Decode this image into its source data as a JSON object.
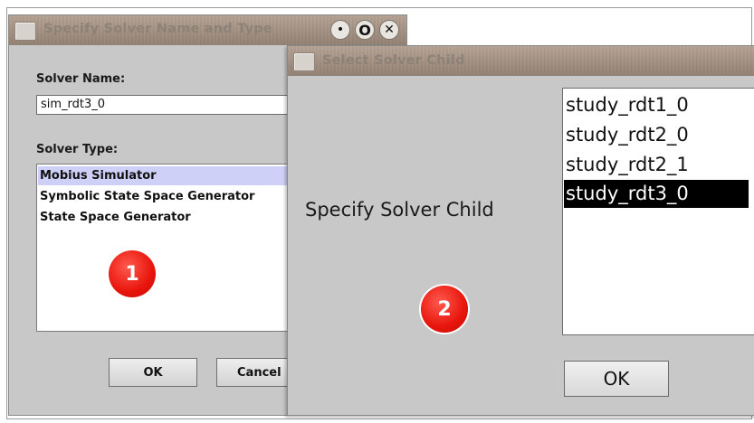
{
  "dialog1": {
    "title": "Specify Solver Name and Type",
    "titlebar_buttons": {
      "minimize": "•",
      "maximize": "O",
      "close": "✕"
    },
    "solver_name_label": "Solver Name:",
    "solver_name_value": "sim_rdt3_0",
    "solver_type_label": "Solver Type:",
    "solver_types": [
      {
        "label": "Mobius Simulator",
        "selected": true
      },
      {
        "label": "Symbolic State Space Generator",
        "selected": false
      },
      {
        "label": "State Space Generator",
        "selected": false
      }
    ],
    "ok_label": "OK",
    "cancel_label": "Cancel"
  },
  "dialog2": {
    "title": "Select Solver Child",
    "prompt": "Specify Solver Child",
    "children": [
      {
        "label": "study_rdt1_0",
        "selected": false
      },
      {
        "label": "study_rdt2_0",
        "selected": false
      },
      {
        "label": "study_rdt2_1",
        "selected": false
      },
      {
        "label": "study_rdt3_0",
        "selected": true
      }
    ],
    "ok_label": "OK"
  },
  "badges": {
    "step1": "1",
    "step2": "2"
  },
  "colors": {
    "badge": "#e8150c",
    "selection_light": "#cfd0f7",
    "selection_dark": "#000000"
  }
}
